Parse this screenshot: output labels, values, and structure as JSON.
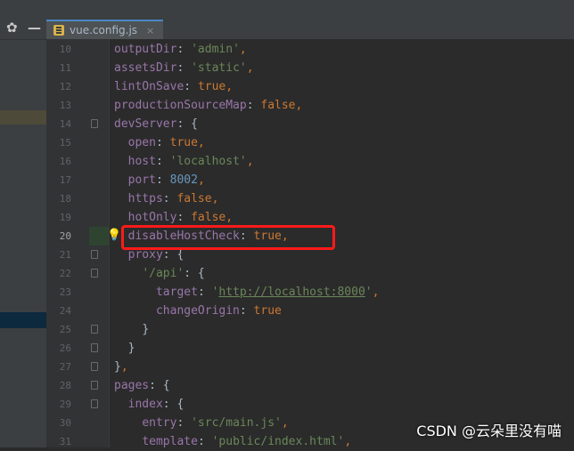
{
  "tab": {
    "label": "vue.config.js",
    "close_glyph": "×"
  },
  "toolbar": {
    "settings_glyph": "✿",
    "minimize_glyph": "—"
  },
  "editor": {
    "current_line": 20,
    "highlight_color": "#ff1a1a",
    "lines": [
      {
        "num": "10",
        "indent": "",
        "parts": [
          [
            "k",
            "outputDir"
          ],
          [
            "p",
            ": "
          ],
          [
            "s",
            "'admin'"
          ],
          [
            "b",
            ","
          ]
        ]
      },
      {
        "num": "11",
        "indent": "",
        "parts": [
          [
            "k",
            "assetsDir"
          ],
          [
            "p",
            ": "
          ],
          [
            "s",
            "'static'"
          ],
          [
            "b",
            ","
          ]
        ]
      },
      {
        "num": "12",
        "indent": "",
        "parts": [
          [
            "k",
            "lintOnSave"
          ],
          [
            "p",
            ": "
          ],
          [
            "b",
            "true,"
          ]
        ]
      },
      {
        "num": "13",
        "indent": "",
        "parts": [
          [
            "k",
            "productionSourceMap"
          ],
          [
            "p",
            ": "
          ],
          [
            "b",
            "false,"
          ]
        ]
      },
      {
        "num": "14",
        "indent": "",
        "fold": true,
        "parts": [
          [
            "k",
            "devServer"
          ],
          [
            "p",
            ": {"
          ]
        ]
      },
      {
        "num": "15",
        "indent": "  ",
        "parts": [
          [
            "k",
            "open"
          ],
          [
            "p",
            ": "
          ],
          [
            "b",
            "true,"
          ]
        ]
      },
      {
        "num": "16",
        "indent": "  ",
        "parts": [
          [
            "k",
            "host"
          ],
          [
            "p",
            ": "
          ],
          [
            "s",
            "'localhost'"
          ],
          [
            "b",
            ","
          ]
        ]
      },
      {
        "num": "17",
        "indent": "  ",
        "parts": [
          [
            "k",
            "port"
          ],
          [
            "p",
            ": "
          ],
          [
            "n",
            "8002"
          ],
          [
            "b",
            ","
          ]
        ]
      },
      {
        "num": "18",
        "indent": "  ",
        "parts": [
          [
            "k",
            "https"
          ],
          [
            "p",
            ": "
          ],
          [
            "b",
            "false,"
          ]
        ]
      },
      {
        "num": "19",
        "indent": "  ",
        "parts": [
          [
            "k",
            "hotOnly"
          ],
          [
            "p",
            ": "
          ],
          [
            "b",
            "false,"
          ]
        ]
      },
      {
        "num": "20",
        "indent": "  ",
        "bulb": true,
        "parts": [
          [
            "k",
            "disableHostCheck"
          ],
          [
            "p",
            ": "
          ],
          [
            "b",
            "true,"
          ]
        ]
      },
      {
        "num": "21",
        "indent": "  ",
        "fold": true,
        "parts": [
          [
            "k",
            "proxy"
          ],
          [
            "p",
            ": {"
          ]
        ]
      },
      {
        "num": "22",
        "indent": "    ",
        "fold": true,
        "parts": [
          [
            "s",
            "'/api'"
          ],
          [
            "p",
            ": {"
          ]
        ]
      },
      {
        "num": "23",
        "indent": "      ",
        "parts": [
          [
            "k",
            "target"
          ],
          [
            "p",
            ": "
          ],
          [
            "s",
            "'"
          ],
          [
            "u",
            "http://localhost:8000"
          ],
          [
            "s",
            "'"
          ],
          [
            "b",
            ","
          ]
        ]
      },
      {
        "num": "24",
        "indent": "      ",
        "parts": [
          [
            "k",
            "changeOrigin"
          ],
          [
            "p",
            ": "
          ],
          [
            "b",
            "true"
          ]
        ]
      },
      {
        "num": "25",
        "indent": "    ",
        "fold": true,
        "parts": [
          [
            "p",
            "}"
          ]
        ]
      },
      {
        "num": "26",
        "indent": "  ",
        "fold": true,
        "parts": [
          [
            "p",
            "}"
          ]
        ]
      },
      {
        "num": "27",
        "indent": "",
        "fold": true,
        "parts": [
          [
            "p",
            "}"
          ],
          [
            "b",
            ","
          ]
        ]
      },
      {
        "num": "28",
        "indent": "",
        "fold": true,
        "parts": [
          [
            "k",
            "pages"
          ],
          [
            "p",
            ": {"
          ]
        ]
      },
      {
        "num": "29",
        "indent": "  ",
        "fold": true,
        "parts": [
          [
            "k",
            "index"
          ],
          [
            "p",
            ": {"
          ]
        ]
      },
      {
        "num": "30",
        "indent": "    ",
        "parts": [
          [
            "k",
            "entry"
          ],
          [
            "p",
            ": "
          ],
          [
            "s",
            "'src/main.js'"
          ],
          [
            "b",
            ","
          ]
        ]
      },
      {
        "num": "31",
        "indent": "    ",
        "parts": [
          [
            "k",
            "template"
          ],
          [
            "p",
            ": "
          ],
          [
            "s",
            "'public/index.html'"
          ],
          [
            "b",
            ","
          ]
        ]
      }
    ]
  },
  "watermark": "CSDN @云朵里没有喵"
}
